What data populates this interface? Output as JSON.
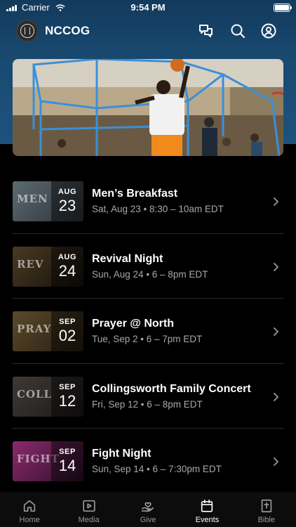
{
  "status_bar": {
    "carrier": "Carrier",
    "time": "9:54 PM"
  },
  "header": {
    "title": "NCCOG"
  },
  "events": [
    {
      "title": "Men’s Breakfast",
      "month": "AUG",
      "day": "23",
      "time": "Sat, Aug 23 • 8:30 – 10am EDT",
      "thumb_word": "MEN",
      "colors": [
        "#5d6a72",
        "#2b3137"
      ]
    },
    {
      "title": "Revival Night",
      "month": "AUG",
      "day": "24",
      "time": "Sun, Aug 24 • 6 – 8pm EDT",
      "thumb_word": "REV",
      "colors": [
        "#4a3a22",
        "#15110b"
      ]
    },
    {
      "title": "Prayer @ North",
      "month": "SEP",
      "day": "02",
      "time": "Tue, Sep 2 • 6 – 7pm EDT",
      "thumb_word": "PRAY",
      "colors": [
        "#5c4a2a",
        "#241b12"
      ]
    },
    {
      "title": "Collingsworth Family Concert",
      "month": "SEP",
      "day": "12",
      "time": "Fri, Sep 12 • 6 – 8pm EDT",
      "thumb_word": "COLL",
      "colors": [
        "#3e3a36",
        "#1a1817"
      ]
    },
    {
      "title": "Fight Night",
      "month": "SEP",
      "day": "14",
      "time": "Sun, Sep 14 • 6 – 7:30pm EDT",
      "thumb_word": "FIGHT",
      "colors": [
        "#8c2a6e",
        "#2a0f26"
      ]
    }
  ],
  "tabs": [
    {
      "label": "Home",
      "icon": "home-icon",
      "active": false
    },
    {
      "label": "Media",
      "icon": "media-icon",
      "active": false
    },
    {
      "label": "Give",
      "icon": "give-icon",
      "active": false
    },
    {
      "label": "Events",
      "icon": "calendar-icon",
      "active": true
    },
    {
      "label": "Bible",
      "icon": "bible-icon",
      "active": false
    }
  ],
  "colors": {
    "header_blue": "#1a4a72",
    "background": "#000000",
    "secondary_text": "#a8a8a8"
  }
}
